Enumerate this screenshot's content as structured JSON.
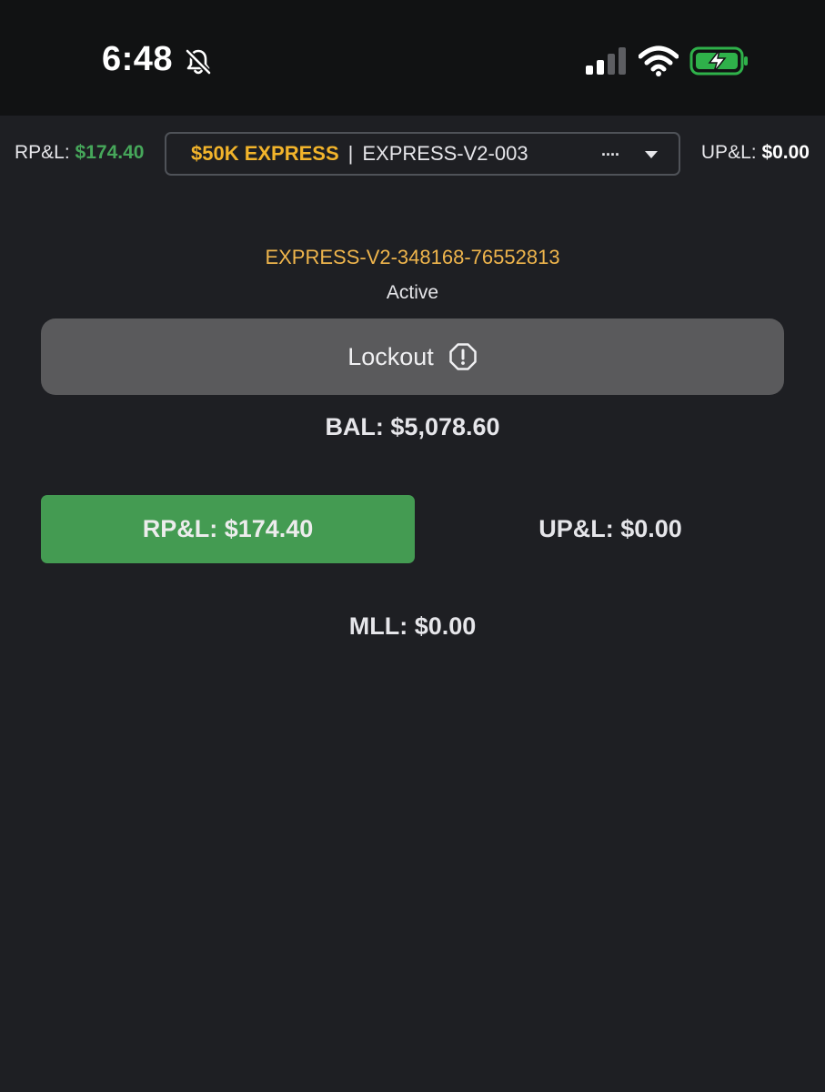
{
  "status_bar": {
    "time": "6:48",
    "icons": [
      "bell-slash-icon",
      "cellular-signal-icon",
      "wifi-icon",
      "battery-charging-icon"
    ]
  },
  "header": {
    "rpl_label": "RP&L:",
    "rpl_value": "$174.40",
    "upl_label": "UP&L:",
    "upl_value": "$0.00",
    "account_selector": {
      "badge": "$50K EXPRESS",
      "separator": "|",
      "name": "EXPRESS-V2-003",
      "truncation": "...."
    }
  },
  "account": {
    "id": "EXPRESS-V2-348168-76552813",
    "status": "Active",
    "lockout_label": "Lockout",
    "balance": "BAL: $5,078.60",
    "rpl": "RP&L: $174.40",
    "upl": "UP&L: $0.00",
    "mll": "MLL: $0.00"
  },
  "colors": {
    "background": "#1e1f23",
    "status_bar_bg": "#111213",
    "accent_yellow": "#f2b42b",
    "account_id": "#efb54c",
    "positive_green": "#449b52",
    "lockout_gray": "#5a5a5c"
  }
}
